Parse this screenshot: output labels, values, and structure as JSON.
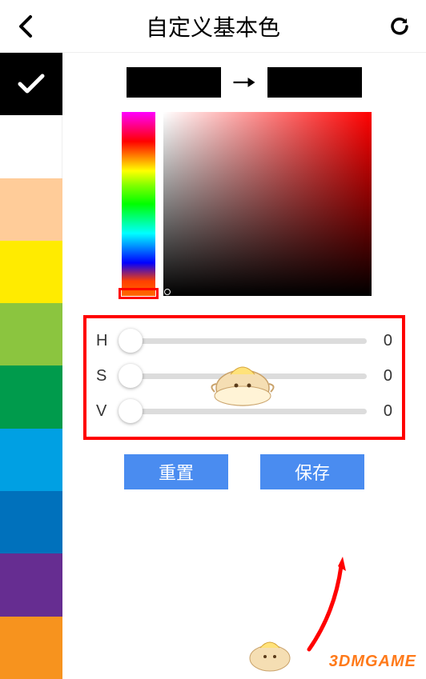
{
  "header": {
    "title": "自定义基本色"
  },
  "preview": {
    "from_color": "#000000",
    "to_color": "#000000"
  },
  "palette": [
    {
      "color": "#000000",
      "selected": true
    },
    {
      "color": "#ffffff",
      "selected": false
    },
    {
      "color": "#ffcc99",
      "selected": false
    },
    {
      "color": "#ffeb00",
      "selected": false
    },
    {
      "color": "#8bc53f",
      "selected": false
    },
    {
      "color": "#009b4c",
      "selected": false
    },
    {
      "color": "#00a0e3",
      "selected": false
    },
    {
      "color": "#0071bc",
      "selected": false
    },
    {
      "color": "#662d91",
      "selected": false
    },
    {
      "color": "#f7931e",
      "selected": false
    }
  ],
  "sliders": {
    "h": {
      "label": "H",
      "value": 0
    },
    "s": {
      "label": "S",
      "value": 0
    },
    "v": {
      "label": "V",
      "value": 0
    }
  },
  "buttons": {
    "reset": "重置",
    "save": "保存"
  },
  "watermark": "3DMGAME"
}
